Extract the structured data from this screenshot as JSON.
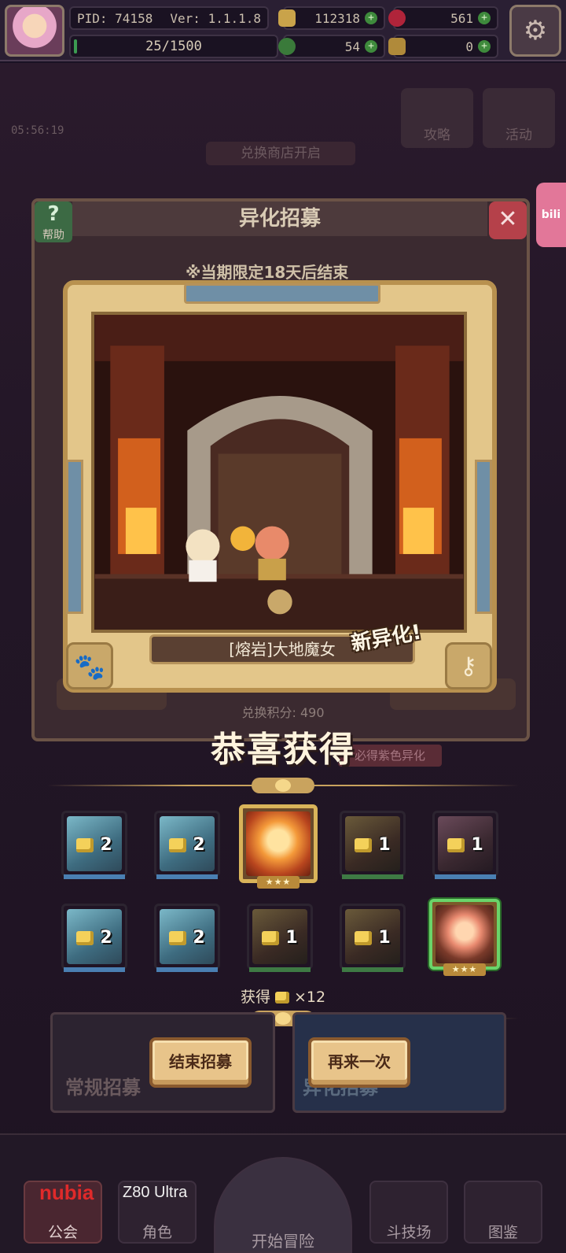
{
  "hud": {
    "pid": "PID: 74158",
    "version": "Ver: 1.1.1.8",
    "exp": "25/1500",
    "exp_fraction": 0.0167,
    "gold": "112318",
    "gems": "561",
    "clover": "54",
    "keys": "0"
  },
  "background": {
    "timer": "05:56:19",
    "exchange_open": "兑换商店开启",
    "guide": "攻略",
    "event": "活动",
    "bili": "bili"
  },
  "panel": {
    "title": "异化招募",
    "help": "帮助",
    "limited": "※当期限定18天后结束",
    "points": "兑换积分: 490",
    "guarantee": "必得紫色异化"
  },
  "card": {
    "name": "[熔岩]大地魔女",
    "new_badge": "新异化!"
  },
  "congrats": "恭喜获得",
  "rewards": {
    "row1": [
      {
        "count": "2",
        "rarity": "blue"
      },
      {
        "count": "2",
        "rarity": "blue"
      },
      {
        "count": "",
        "rarity": "gold"
      },
      {
        "count": "1",
        "rarity": "green"
      },
      {
        "count": "1",
        "rarity": "purple"
      }
    ],
    "row2": [
      {
        "count": "2",
        "rarity": "blue"
      },
      {
        "count": "2",
        "rarity": "blue"
      },
      {
        "count": "1",
        "rarity": "green"
      },
      {
        "count": "1",
        "rarity": "green"
      },
      {
        "count": "",
        "rarity": "selected"
      }
    ],
    "stars": "★★★",
    "obtained_label": "获得",
    "obtained_count": "×12"
  },
  "buttons": {
    "end": "结束招募",
    "again": "再来一次",
    "normal_banner": "常规招募",
    "alt_banner": "异化招募"
  },
  "nav": {
    "guild": "公会",
    "role": "角色",
    "start": "开始冒险",
    "arena": "斗技场",
    "codex": "图鉴"
  },
  "watermark": {
    "brand": "nubia",
    "model": "Z80 Ultra"
  },
  "colors": {
    "accent_gold": "#d9b45a",
    "button_face": "#e8c48a",
    "selected_border": "#6ad46a"
  }
}
